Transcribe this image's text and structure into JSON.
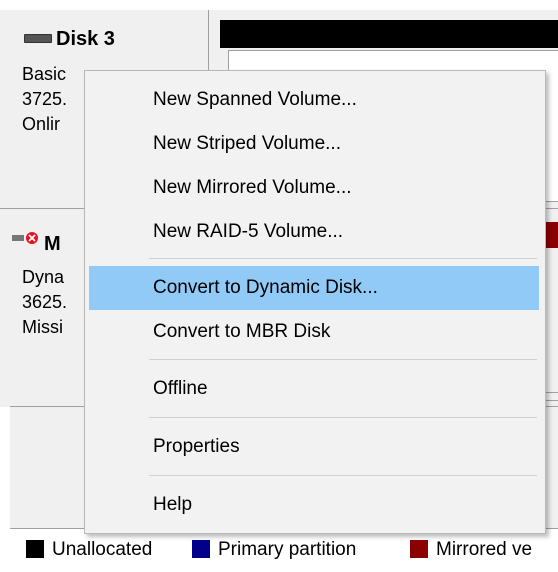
{
  "disks": {
    "disk3": {
      "title": "Disk 3",
      "type": "Basic",
      "size": "3725.",
      "status": "Onlir"
    },
    "missing": {
      "title": "M",
      "type": "Dyna",
      "size": "3625.",
      "status": "Missi"
    }
  },
  "context_menu": {
    "items": [
      {
        "label": "New Spanned Volume..."
      },
      {
        "label": "New Striped Volume..."
      },
      {
        "label": "New Mirrored Volume..."
      },
      {
        "label": "New RAID-5 Volume..."
      },
      {
        "label": "Convert to Dynamic Disk..."
      },
      {
        "label": "Convert to MBR Disk"
      },
      {
        "label": "Offline"
      },
      {
        "label": "Properties"
      },
      {
        "label": "Help"
      }
    ],
    "highlighted_index": 4
  },
  "legend": {
    "items": [
      {
        "label": "Unallocated",
        "color": "#000000"
      },
      {
        "label": "Primary partition",
        "color": "#00008b"
      },
      {
        "label": "Mirrored ve",
        "color": "#8b0000"
      }
    ]
  },
  "colors": {
    "highlight": "#91c9f7",
    "menu_bg": "#f2f2f2",
    "missing_icon": "#e81123"
  }
}
